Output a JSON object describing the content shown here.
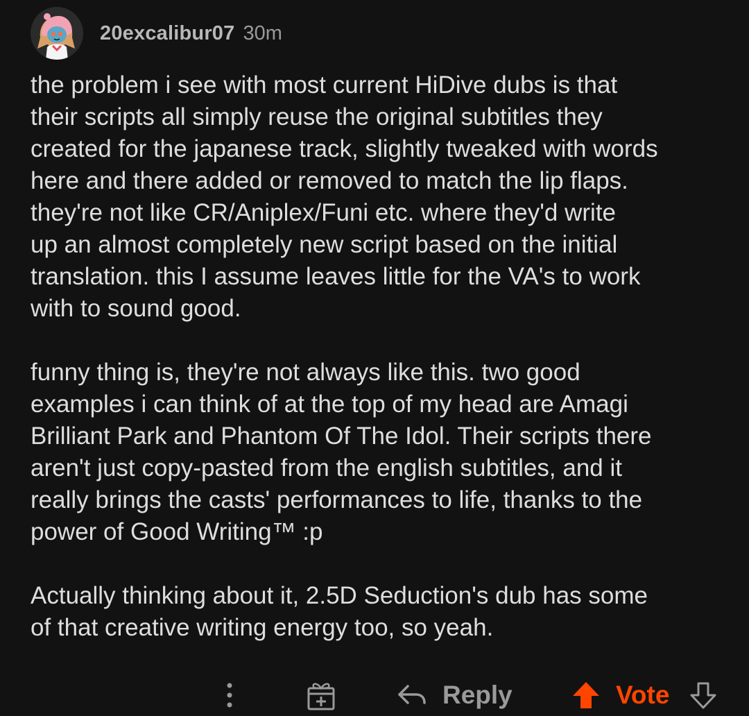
{
  "comment": {
    "author": "20excalibur07",
    "timestamp": "30m",
    "paragraphs": [
      {
        "lines": [
          "the problem i see with most current HiDive dubs is that",
          "their scripts all simply reuse the original subtitles they",
          "created for the japanese track, slightly tweaked with words",
          "here and there added or removed to match the lip flaps.",
          "they're not like CR/Aniplex/Funi etc. where they'd write",
          "up an almost completely new script based on the initial",
          "translation. this I assume leaves little for the VA's to work",
          "with to sound good."
        ]
      },
      {
        "lines": [
          "funny thing is, they're not always like this. two good",
          "examples i can think of at the top of my head are Amagi",
          "Brilliant Park and Phantom Of The Idol. Their scripts there",
          "aren't just copy-pasted from the english subtitles, and it",
          "really brings the casts' performances to life, thanks to the",
          "power of Good Writing™ :p"
        ]
      },
      {
        "lines": [
          "Actually thinking about it, 2.5D Seduction's dub has some",
          "of that creative writing energy too, so yeah."
        ]
      }
    ]
  },
  "actions": {
    "more_icon": "vertical-ellipsis-icon",
    "award_icon": "gift-icon",
    "reply_icon": "reply-arrow-icon",
    "reply_label": "Reply",
    "upvote_icon": "arrow-up-icon",
    "vote_label": "Vote",
    "downvote_icon": "arrow-down-icon"
  },
  "colors": {
    "background": "#121212",
    "text": "#dedede",
    "muted": "#9a9a9a",
    "upvote_accent": "#ff4500"
  }
}
